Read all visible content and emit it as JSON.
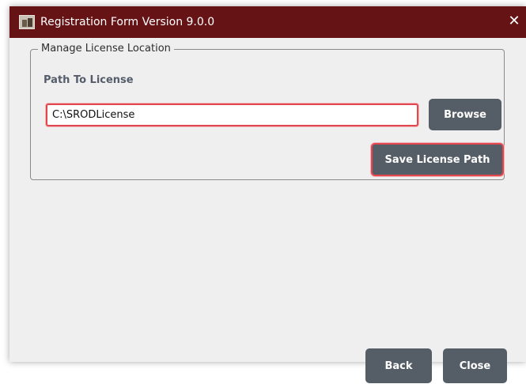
{
  "window": {
    "title": "Registration Form Version 9.0.0",
    "close_symbol": "✕",
    "colors": {
      "titlebar": "#661315",
      "panel": "#efefef",
      "button": "#555d66",
      "highlight": "#e0474f"
    }
  },
  "group": {
    "legend": "Manage License Location",
    "path_label": "Path To License",
    "path_value": "C:\\SRODLicense"
  },
  "buttons": {
    "browse": "Browse",
    "save": "Save License Path",
    "back": "Back",
    "close": "Close"
  },
  "icons": {
    "app_icon": "app-icon",
    "close_icon": "close-icon"
  }
}
